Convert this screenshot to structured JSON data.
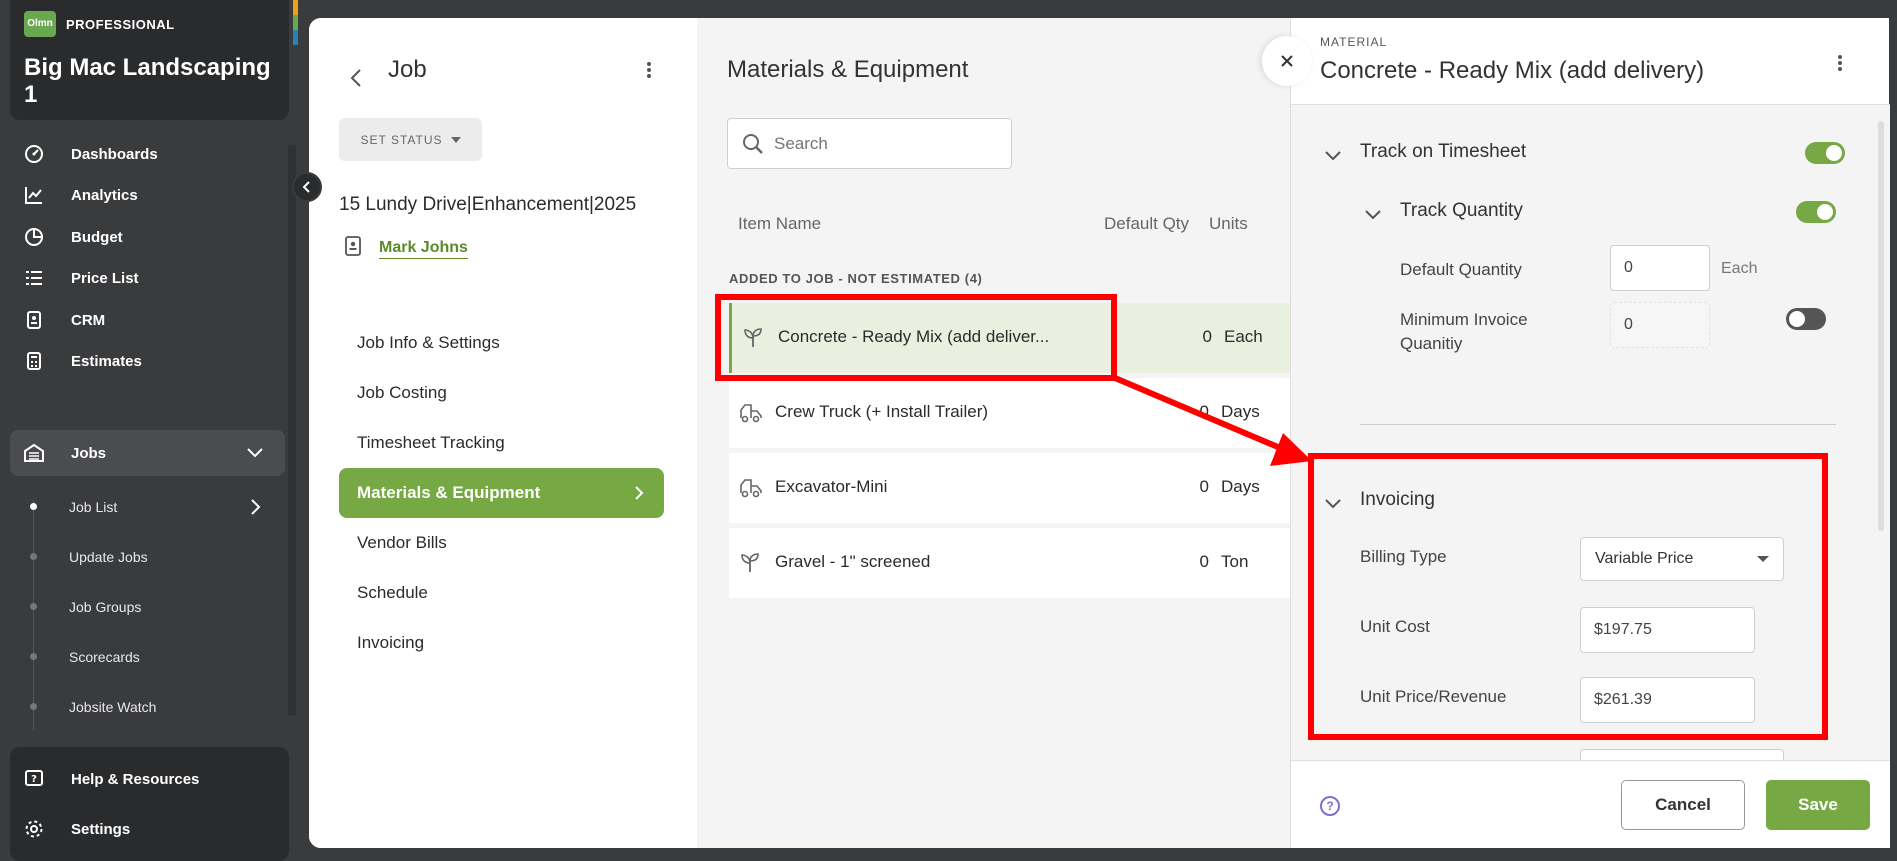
{
  "org": {
    "logo_text": "Olmn",
    "tier": "PROFESSIONAL",
    "name": "Big Mac Landscaping 1",
    "accent_colors": [
      "#e8a317",
      "#6aa84f",
      "#2e7fb8"
    ]
  },
  "nav": {
    "items": [
      {
        "label": "Dashboards",
        "icon": "dashboard-gauge-icon"
      },
      {
        "label": "Analytics",
        "icon": "line-chart-icon"
      },
      {
        "label": "Budget",
        "icon": "pie-chart-icon"
      },
      {
        "label": "Price List",
        "icon": "list-icon"
      },
      {
        "label": "CRM",
        "icon": "contact-card-icon"
      },
      {
        "label": "Estimates",
        "icon": "calculator-icon"
      },
      {
        "label": "Jobs",
        "icon": "garage-icon"
      }
    ],
    "sub_items": [
      {
        "label": "Job List"
      },
      {
        "label": "Update Jobs"
      },
      {
        "label": "Job Groups"
      },
      {
        "label": "Scorecards"
      },
      {
        "label": "Jobsite Watch"
      }
    ],
    "bottom_items": [
      {
        "label": "Help & Resources",
        "icon": "help-icon"
      },
      {
        "label": "Settings",
        "icon": "gear-icon"
      }
    ]
  },
  "job": {
    "heading": "Job",
    "set_status_label": "SET STATUS",
    "address": "15 Lundy Drive|Enhancement|2025",
    "contact": "Mark Johns",
    "menu": [
      {
        "label": "Job Info & Settings"
      },
      {
        "label": "Job Costing"
      },
      {
        "label": "Timesheet Tracking"
      },
      {
        "label": "Materials & Equipment"
      },
      {
        "label": "Vendor Bills"
      },
      {
        "label": "Schedule"
      },
      {
        "label": "Invoicing"
      }
    ]
  },
  "materials": {
    "title": "Materials & Equipment",
    "search_placeholder": "Search",
    "columns": {
      "name": "Item Name",
      "qty": "Default Qty",
      "units": "Units"
    },
    "group_label": "ADDED TO JOB - NOT ESTIMATED (4)",
    "rows": [
      {
        "name": "Concrete - Ready Mix (add deliver...",
        "qty": "0",
        "unit": "Each",
        "icon": "sprout-icon"
      },
      {
        "name": "Crew Truck (+ Install Trailer)",
        "qty": "0",
        "unit": "Days",
        "icon": "truck-icon"
      },
      {
        "name": "Excavator-Mini",
        "qty": "0",
        "unit": "Days",
        "icon": "truck-icon"
      },
      {
        "name": "Gravel - 1\" screened",
        "qty": "0",
        "unit": "Ton",
        "icon": "sprout-icon"
      }
    ]
  },
  "drawer": {
    "eyebrow": "MATERIAL",
    "title": "Concrete - Ready Mix (add delivery)",
    "track_timesheet": {
      "label": "Track on Timesheet",
      "on": true
    },
    "track_quantity": {
      "label": "Track Quantity",
      "on": true
    },
    "default_quantity": {
      "label": "Default Quantity",
      "value": "0",
      "unit": "Each"
    },
    "min_invoice_qty": {
      "label": "Minimum Invoice Quanitiy",
      "value": "0",
      "on": false
    },
    "invoicing": {
      "title": "Invoicing",
      "billing_type_label": "Billing Type",
      "billing_type_value": "Variable Price",
      "unit_cost_label": "Unit Cost",
      "unit_cost_value": "$197.75",
      "unit_price_label": "Unit Price/Revenue",
      "unit_price_value": "$261.39"
    },
    "help_glyph": "?",
    "cancel_label": "Cancel",
    "save_label": "Save"
  },
  "colors": {
    "brand_green": "#76a844",
    "annotation_red": "#ff0000"
  }
}
